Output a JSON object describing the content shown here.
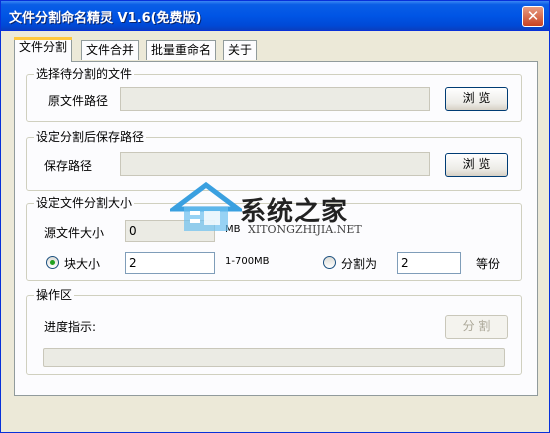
{
  "window": {
    "title": "文件分割命名精灵 V1.6(免费版)",
    "close_glyph": "✕"
  },
  "tabs": [
    {
      "label": "文件分割",
      "active": true
    },
    {
      "label": "文件合并",
      "active": false
    },
    {
      "label": "批量重命名",
      "active": false
    },
    {
      "label": "关于",
      "active": false
    }
  ],
  "select_file": {
    "title": "选择待分割的文件",
    "source_label": "原文件路径",
    "source_value": "",
    "browse_label": "浏 览"
  },
  "save_path": {
    "title": "设定分割后保存路径",
    "path_label": "保存路径",
    "path_value": "",
    "browse_label": "浏 览"
  },
  "split_size": {
    "title": "设定文件分割大小",
    "source_size_label": "源文件大小",
    "source_size_value": "0",
    "source_size_unit": "MB",
    "block_size_label": "块大小",
    "block_size_value": "2",
    "block_size_range": "1-700MB",
    "split_into_label": "分割为",
    "split_into_value": "2",
    "split_into_unit": "等份",
    "selected_mode": "block_size"
  },
  "operation": {
    "title": "操作区",
    "progress_label": "进度指示:",
    "progress_fraction": 0,
    "split_button_label": "分 割"
  },
  "watermark": {
    "title": "系统之家",
    "subtitle": "XITONGZHIJIA.NET",
    "icon": "house-logo-icon"
  },
  "colors": {
    "titlebar": "#0055e5",
    "window_bg": "#ece9d8",
    "tab_highlight": "#ffc83c",
    "close_button": "#c84221",
    "radio_dot": "#21a121"
  }
}
